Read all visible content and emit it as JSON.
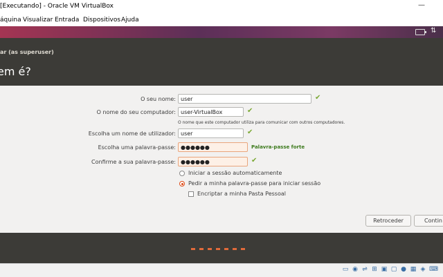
{
  "window": {
    "title": "[Executando] - Oracle VM VirtualBox",
    "minimize_glyph": "—"
  },
  "menubar": {
    "items": [
      "áquina",
      "Visualizar",
      "Entrada",
      "Dispositivos",
      "Ajuda"
    ]
  },
  "top_panel": {
    "battery_icon": "battery-icon",
    "network_icon": "network-icon",
    "network_glyph": "⇅"
  },
  "dialog": {
    "title": "ar (as superuser)",
    "heading": "em é?"
  },
  "form": {
    "name_label": "O seu nome:",
    "name_value": "user",
    "computer_label": "O nome do seu computador:",
    "computer_value": "user-VirtualBox",
    "computer_hint": "O nome que este computador utiliza para comunicar com outros computadores.",
    "username_label": "Escolha um nome de utilizador:",
    "username_value": "user",
    "password_label": "Escolha uma palavra-passe:",
    "password_mask": "●●●●●●",
    "password_strength": "Palavra-passe forte",
    "confirm_label": "Confirme a sua palavra-passe:",
    "confirm_mask": "●●●●●●",
    "check_glyph": "✔"
  },
  "login_options": {
    "auto_login": "Iniciar a sessão automaticamente",
    "require_password": "Pedir a minha palavra-passe para iniciar sessão",
    "encrypt_home": "Encriptar a minha Pasta Pessoal",
    "selected": "require_password"
  },
  "buttons": {
    "back": "Retroceder",
    "continue": "Contin"
  },
  "progress": {
    "total_steps": 7
  },
  "colors": {
    "accent": "#dd4814",
    "check_green": "#7aa832",
    "strength_green": "#3c7a1c",
    "dark_bg": "#3c3b37"
  },
  "statusbar": {
    "icons": [
      "hdd-icon",
      "optical-icon",
      "usb-icon",
      "network-icon",
      "shared-folder-icon",
      "display-icon",
      "recording-icon",
      "cpu-icon",
      "mouse-icon",
      "keyboard-icon"
    ]
  }
}
